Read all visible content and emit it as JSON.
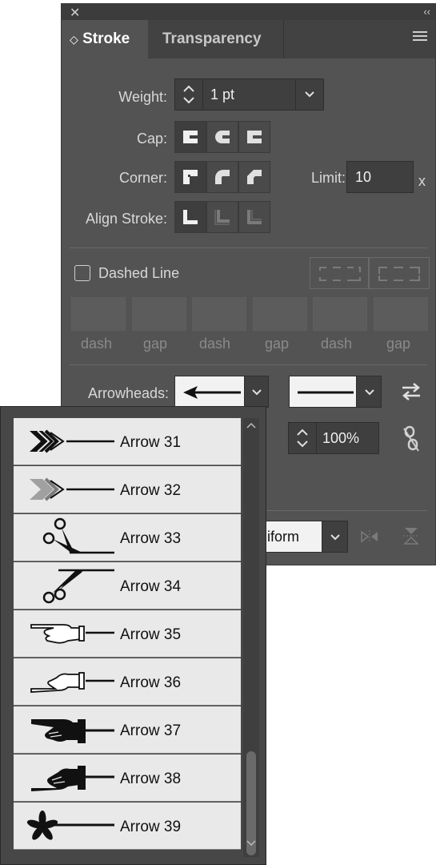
{
  "panel": {
    "tabs": [
      {
        "label": "Stroke"
      },
      {
        "label": "Transparency"
      }
    ],
    "weight": {
      "label": "Weight:",
      "value": "1 pt"
    },
    "cap": {
      "label": "Cap:"
    },
    "corner": {
      "label": "Corner:",
      "limit_label": "Limit:",
      "limit_value": "10",
      "limit_suffix": "x"
    },
    "align": {
      "label": "Align Stroke:"
    },
    "dashed": {
      "label": "Dashed Line",
      "checked": false,
      "fields": [
        "dash",
        "gap",
        "dash",
        "gap",
        "dash",
        "gap"
      ]
    },
    "arrowheads": {
      "label": "Arrowheads:"
    },
    "scale": {
      "value": "100%"
    },
    "align_arrow": {
      "partial_label": "iform"
    }
  },
  "dropdown": {
    "items": [
      {
        "label": "Arrow 31",
        "icon": "chevron-fletching-arrow-icon"
      },
      {
        "label": "Arrow 32",
        "icon": "gray-fletching-arrow-icon"
      },
      {
        "label": "Arrow 33",
        "icon": "scissors-open-icon"
      },
      {
        "label": "Arrow 34",
        "icon": "scissors-closed-icon"
      },
      {
        "label": "Arrow 35",
        "icon": "pointing-hand-outline-icon"
      },
      {
        "label": "Arrow 36",
        "icon": "pointing-hand-outline-alt-icon"
      },
      {
        "label": "Arrow 37",
        "icon": "pointing-hand-filled-icon"
      },
      {
        "label": "Arrow 38",
        "icon": "pointing-hand-filled-alt-icon"
      },
      {
        "label": "Arrow 39",
        "icon": "asterisk-line-icon"
      }
    ]
  }
}
